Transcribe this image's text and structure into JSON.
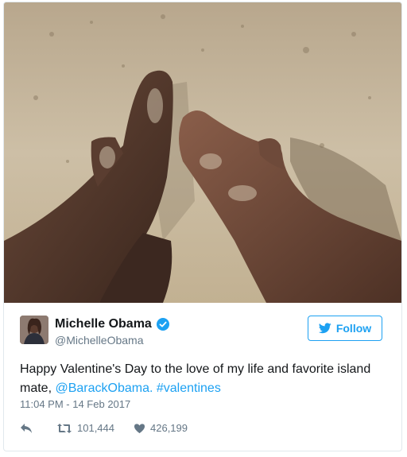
{
  "user": {
    "display_name": "Michelle Obama",
    "handle": "@MichelleObama",
    "verified": true
  },
  "follow_button": {
    "label": "Follow"
  },
  "tweet": {
    "text_main": "Happy Valentine's Day to the love of my life and favorite island mate, ",
    "mention": "@BarackObama.",
    "hashtag": "#valentines",
    "timestamp": "11:04 PM - 14 Feb 2017"
  },
  "stats": {
    "retweets": "101,444",
    "likes": "426,199"
  },
  "icons": {
    "reply": "reply-icon",
    "retweet": "retweet-icon",
    "like": "heart-icon",
    "verified": "verified-badge-icon",
    "follow": "twitter-bird-icon"
  },
  "colors": {
    "accent": "#1da1f2",
    "text": "#14171a",
    "muted": "#657786",
    "border": "#e1e8ed"
  }
}
